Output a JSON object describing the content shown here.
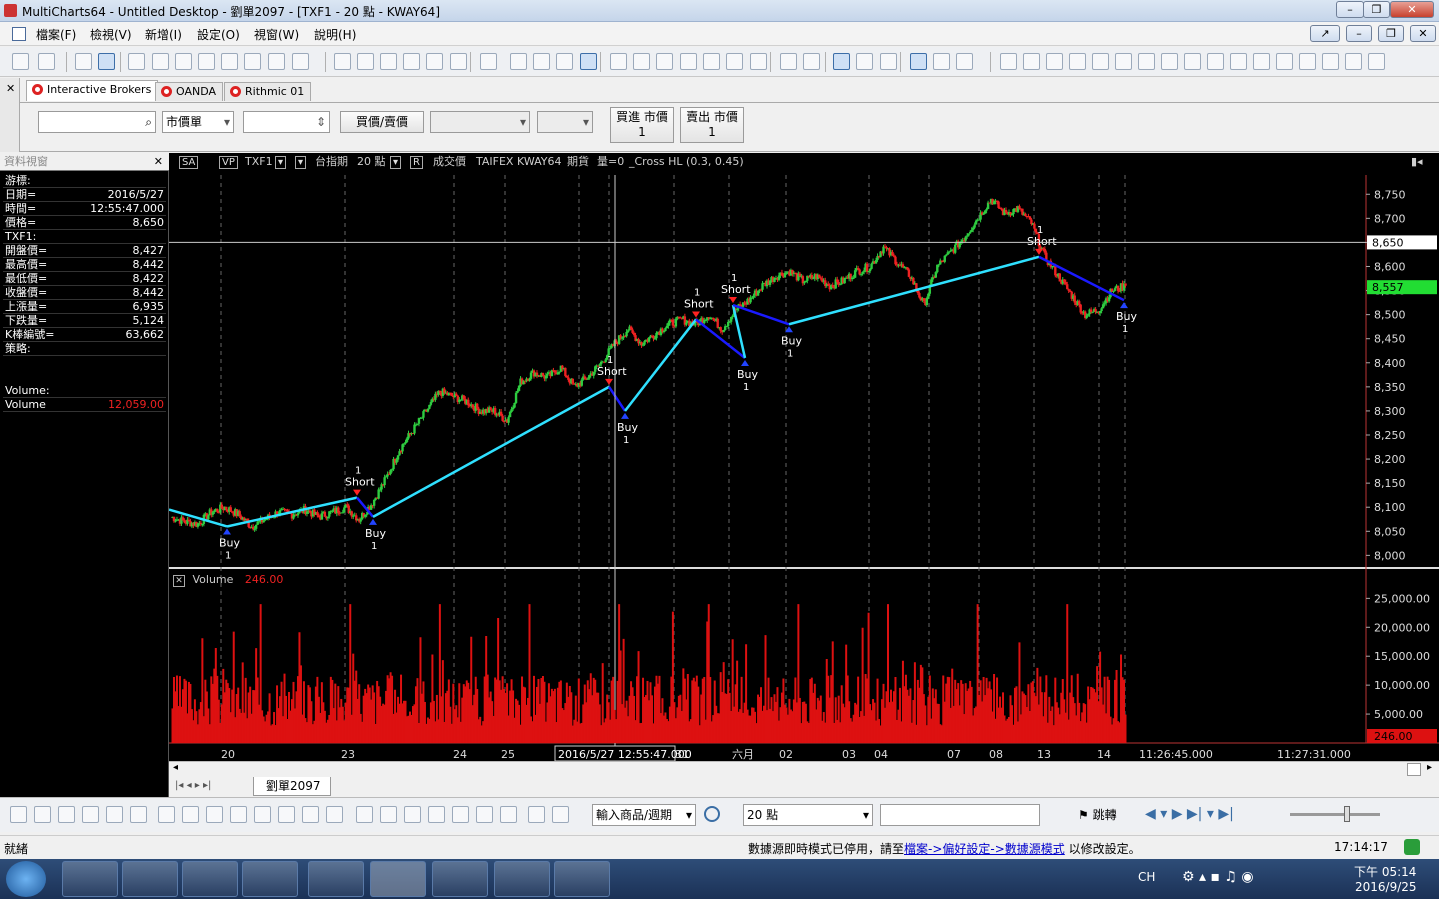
{
  "window": {
    "title": "MultiCharts64 - Untitled Desktop - 劉單2097 - [TXF1 - 20 點 - KWAY64]"
  },
  "menu": [
    "檔案(F)",
    "檢視(V)",
    "新增(I)",
    "設定(O)",
    "視窗(W)",
    "說明(H)"
  ],
  "brokers": {
    "tabs": [
      "Interactive Brokers",
      "OANDA",
      "Rithmic 01"
    ]
  },
  "order": {
    "order_type": "市價單",
    "price_mode": "買價/賣價",
    "buy_market_label": "買進 市價",
    "buy_market_qty": "1",
    "sell_market_label": "賣出 市價",
    "sell_market_qty": "1"
  },
  "data_window": {
    "title": "資料視窗",
    "cursor_section": "游標:",
    "cursor_rows": [
      {
        "k": "日期=",
        "v": "2016/5/27"
      },
      {
        "k": "時間=",
        "v": "12:55:47.000"
      },
      {
        "k": "價格=",
        "v": "8,650"
      }
    ],
    "symbol_section": "TXF1:",
    "symbol_rows": [
      {
        "k": "開盤價=",
        "v": "8,427"
      },
      {
        "k": "最高價=",
        "v": "8,442"
      },
      {
        "k": "最低價=",
        "v": "8,422"
      },
      {
        "k": "收盤價=",
        "v": "8,442"
      },
      {
        "k": "上漲量=",
        "v": "6,935"
      },
      {
        "k": "下跌量=",
        "v": "5,124"
      },
      {
        "k": "K棒編號=",
        "v": "63,662"
      }
    ],
    "strategy_section": "策略:",
    "volume_section": "Volume:",
    "volume_row": {
      "k": "Volume",
      "v": "12,059.00"
    }
  },
  "chart_header": {
    "sa": "SA",
    "vp": "VP",
    "symbol": "TXF1",
    "description": "台指期",
    "interval": "20 點",
    "r": "R",
    "data_type": "成交價",
    "exchange": "TAIFEX",
    "bar_type": "KWAY64",
    "category": "期貨",
    "volume_flag": "量=0",
    "study": "_Cross HL (0.3,  0.45)"
  },
  "volume_header": {
    "name": "Volume",
    "value": "246.00"
  },
  "chart_data": {
    "type": "candlestick",
    "symbol": "TXF1",
    "price_axis": [
      8000,
      8050,
      8100,
      8150,
      8200,
      8250,
      8300,
      8350,
      8400,
      8450,
      8500,
      8550,
      8600,
      8650,
      8700,
      8750
    ],
    "price_axis_labels": [
      "8,000",
      "8,050",
      "8,100",
      "8,150",
      "8,200",
      "8,250",
      "8,300",
      "8,350",
      "8,400",
      "8,450",
      "8,500",
      "8,550",
      "8,600",
      "8,650",
      "8,700",
      "8,750"
    ],
    "ylim": [
      7980,
      8790
    ],
    "cursor_price": 8650,
    "cursor_price_label": "8,650",
    "last_price": 8557,
    "last_price_label": "8,557",
    "x_axis_labels": [
      "20",
      "23",
      "24",
      "25",
      "31",
      "六月",
      "02",
      "03",
      "04",
      "07",
      "08",
      "13",
      "14",
      "11:26:45.000",
      "11:27:31.000"
    ],
    "cursor_time_label": "2016/5/27 12:55:47.000",
    "price_path": [
      8080,
      8070,
      8065,
      8090,
      8100,
      8085,
      8060,
      8075,
      8090,
      8085,
      8095,
      8080,
      8090,
      8100,
      8075,
      8110,
      8160,
      8220,
      8260,
      8300,
      8340,
      8330,
      8320,
      8300,
      8300,
      8280,
      8360,
      8380,
      8370,
      8390,
      8350,
      8370,
      8400,
      8440,
      8470,
      8440,
      8460,
      8480,
      8490,
      8480,
      8500,
      8470,
      8510,
      8530,
      8560,
      8580,
      8590,
      8570,
      8580,
      8560,
      8570,
      8590,
      8600,
      8640,
      8610,
      8580,
      8520,
      8600,
      8630,
      8660,
      8700,
      8740,
      8710,
      8720,
      8690,
      8620,
      8580,
      8540,
      8500,
      8510,
      8550,
      8560
    ],
    "signals": [
      {
        "label": "Buy",
        "qty": "1",
        "price": 8060
      },
      {
        "label": "Short",
        "qty": "1",
        "price": 8120
      },
      {
        "label": "Buy",
        "qty": "1",
        "price": 8080
      },
      {
        "label": "Short",
        "qty": "1",
        "price": 8350
      },
      {
        "label": "Buy",
        "qty": "1",
        "price": 8300
      },
      {
        "label": "Short",
        "qty": "1",
        "price": 8490
      },
      {
        "label": "Buy",
        "qty": "1",
        "price": 8410
      },
      {
        "label": "Short",
        "qty": "1",
        "price": 8520
      },
      {
        "label": "Buy",
        "qty": "1",
        "price": 8480
      },
      {
        "label": "Short",
        "qty": "1",
        "price": 8620
      },
      {
        "label": "Buy",
        "qty": "1",
        "price": 8530
      }
    ],
    "volume_axis": [
      5000,
      10000,
      15000,
      20000,
      25000
    ],
    "volume_axis_labels": [
      "5,000.00",
      "10,000.00",
      "15,000.00",
      "20,000.00",
      "25,000.00"
    ],
    "volume_ylim": [
      0,
      28000
    ],
    "last_volume_label": "246.00"
  },
  "sheet_tab": "劉單2097",
  "bottom": {
    "symbol_period": "輸入商品/週期",
    "interval": "20 點",
    "jump": "跳轉"
  },
  "status": {
    "left": "就緒",
    "message_prefix": "數據源即時模式已停用，請至",
    "message_link": "檔案->偏好設定->數據源模式",
    "message_suffix": "以修改設定。",
    "clock": "17:14:17"
  },
  "tray": {
    "lang": "CH",
    "time": "下午 05:14",
    "date": "2016/9/25"
  },
  "colors": {
    "up": "#2ecc40",
    "down": "#ee2222",
    "cyan": "#2fe0ff",
    "blue": "#1a1aff",
    "volume": "#dd1111"
  }
}
